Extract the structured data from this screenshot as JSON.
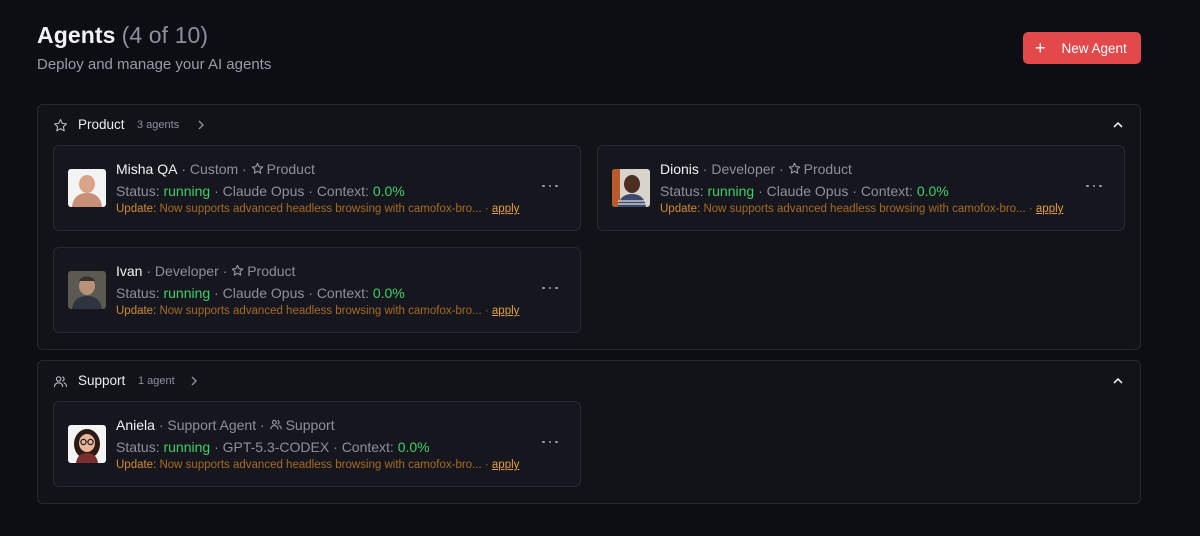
{
  "header": {
    "title": "Agents",
    "count": "(4 of 10)",
    "subtitle": "Deploy and manage your AI agents",
    "new_agent_label": "New Agent"
  },
  "groups": [
    {
      "name": "Product",
      "count": "3 agents",
      "agents": [
        {
          "name": "Misha QA",
          "role": "Custom",
          "team": "Product",
          "status": "running",
          "model": "Claude Opus",
          "context": "0.0%",
          "update": "Now supports advanced headless browsing with camofox-bro...",
          "apply": "apply"
        },
        {
          "name": "Dionis",
          "role": "Developer",
          "team": "Product",
          "status": "running",
          "model": "Claude Opus",
          "context": "0.0%",
          "update": "Now supports advanced headless browsing with camofox-bro...",
          "apply": "apply"
        },
        {
          "name": "Ivan",
          "role": "Developer",
          "team": "Product",
          "status": "running",
          "model": "Claude Opus",
          "context": "0.0%",
          "update": "Now supports advanced headless browsing with camofox-bro...",
          "apply": "apply"
        }
      ]
    },
    {
      "name": "Support",
      "count": "1 agent",
      "agents": [
        {
          "name": "Aniela",
          "role": "Support Agent",
          "team": "Support",
          "status": "running",
          "model": "GPT-5.3-CODEX",
          "context": "0.0%",
          "update": "Now supports advanced headless browsing with camofox-bro...",
          "apply": "apply"
        }
      ]
    }
  ],
  "labels": {
    "status": "Status:",
    "context": "Context:",
    "update": "Update:",
    "sep": "·"
  },
  "colors": {
    "accent": "#e2494b",
    "running": "#3ecf6a",
    "update": "#d08a2c"
  }
}
